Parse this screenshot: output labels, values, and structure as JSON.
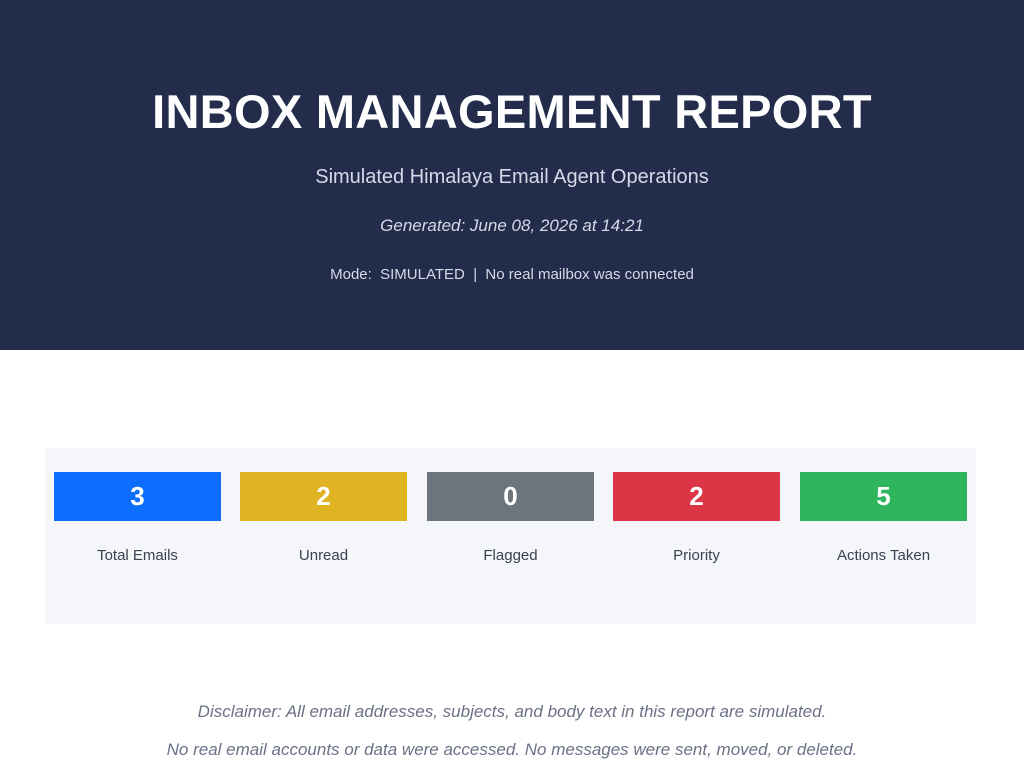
{
  "header": {
    "title": "INBOX MANAGEMENT REPORT",
    "subtitle": "Simulated Himalaya Email Agent Operations",
    "generated": "Generated: June 08, 2026 at 14:21",
    "mode_line": "Mode:  SIMULATED  |  No real mailbox was connected"
  },
  "stats": [
    {
      "value": "3",
      "label": "Total Emails",
      "color": "#0d6efd"
    },
    {
      "value": "2",
      "label": "Unread",
      "color": "#e0b323"
    },
    {
      "value": "0",
      "label": "Flagged",
      "color": "#6c757d"
    },
    {
      "value": "2",
      "label": "Priority",
      "color": "#dc3545"
    },
    {
      "value": "5",
      "label": "Actions Taken",
      "color": "#2fb55c"
    }
  ],
  "disclaimer": {
    "line1": "Disclaimer: All email addresses, subjects, and body text in this report are simulated.",
    "line2": "No real email accounts or data were accessed. No messages were sent, moved, or deleted."
  }
}
